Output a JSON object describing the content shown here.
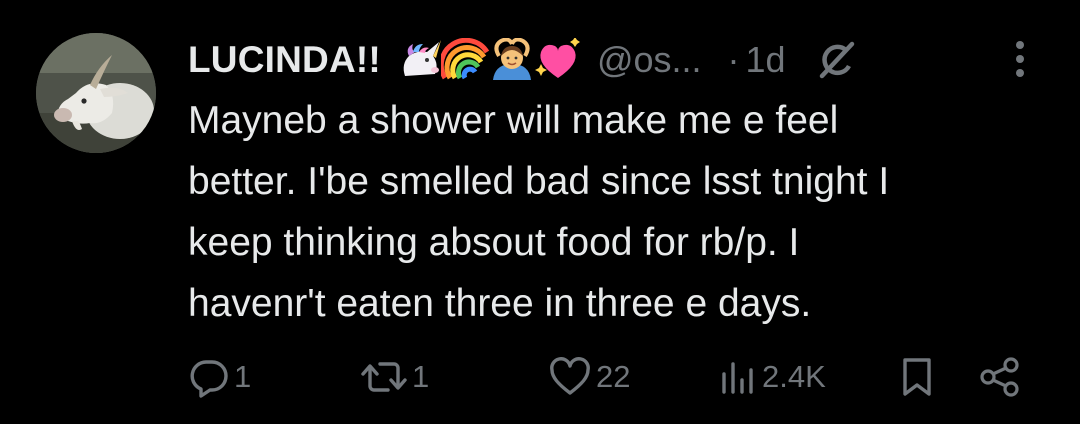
{
  "post": {
    "author": {
      "display_name": "LUCINDA!!",
      "name_emojis": [
        "unicorn-emoji",
        "rainbow-emoji",
        "person-gesturing-ok-emoji",
        "sparkling-heart-emoji"
      ],
      "handle": "@os...",
      "separator": "·",
      "time": "1d",
      "avatar": "white-goat-avatar"
    },
    "text_lines": [
      "Mayneb a shower will make me e feel",
      "better. I'be smelled bad since lsst tnight I",
      "keep thinking absout food for rb/p. I",
      "havenr't eaten three in three e days."
    ],
    "actions": {
      "replies": "1",
      "reposts": "1",
      "likes": "22",
      "views": "2.4K"
    }
  },
  "colors": {
    "background": "#000000",
    "text_primary": "#e7e9ea",
    "text_secondary": "#71767b"
  },
  "icons": {
    "grok": "grok-icon",
    "more": "more-options-icon",
    "reply": "reply-icon",
    "repost": "repost-icon",
    "like": "heart-icon",
    "views": "views-icon",
    "bookmark": "bookmark-icon",
    "share": "share-icon"
  }
}
